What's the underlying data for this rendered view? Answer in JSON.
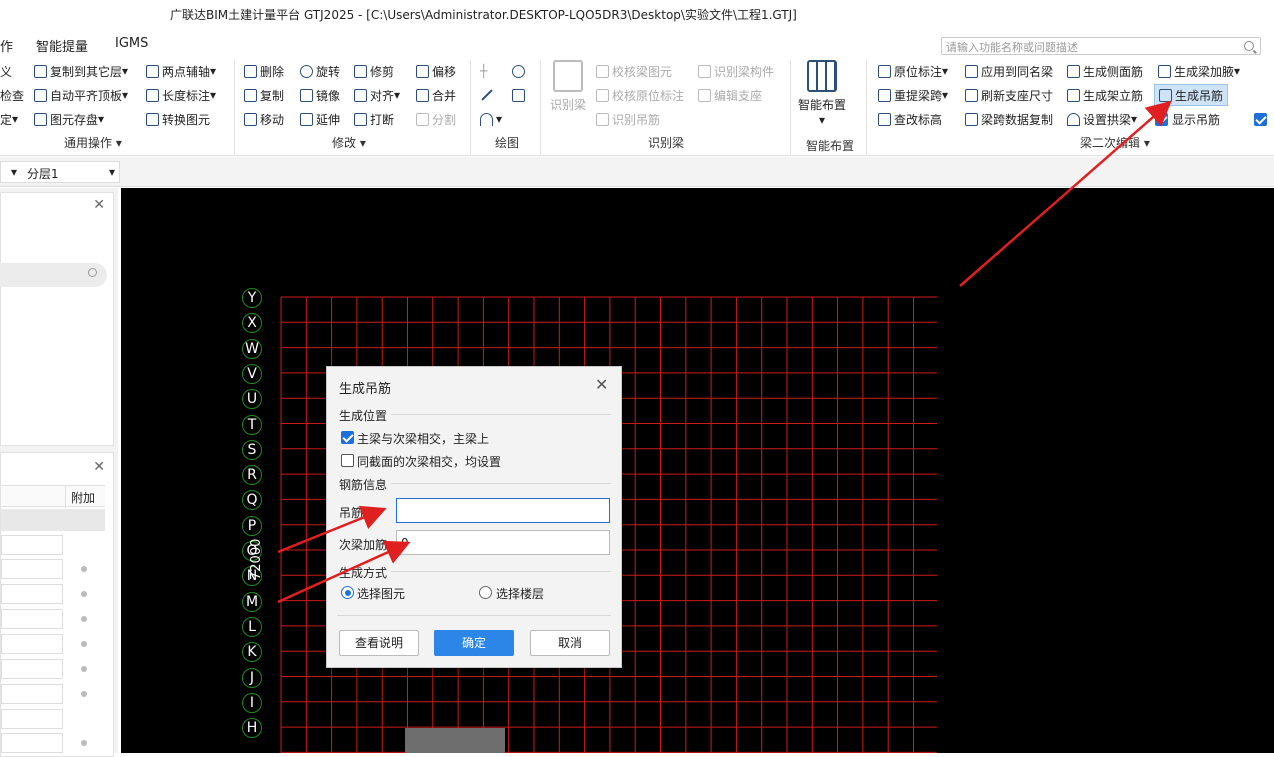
{
  "window": {
    "title": "广联达BIM土建计量平台 GTJ2025 - [C:\\Users\\Administrator.DESKTOP-LQO5DR3\\Desktop\\实验文件\\工程1.GTJ]"
  },
  "menubar": {
    "items": [
      "作",
      "智能提量",
      "IGMS"
    ]
  },
  "search": {
    "placeholder": "请输入功能名称或问题描述"
  },
  "ribbon": {
    "general": {
      "left_clipped": [
        "义",
        "检查",
        "定"
      ],
      "items": [
        "复制到其它层",
        "两点辅轴",
        "自动平齐顶板",
        "长度标注",
        "图元存盘",
        "转换图元"
      ],
      "label": "通用操作"
    },
    "modify": {
      "items": [
        "删除",
        "旋转",
        "修剪",
        "偏移",
        "复制",
        "镜像",
        "对齐",
        "合并",
        "移动",
        "延伸",
        "打断",
        "分割"
      ],
      "label": "修改"
    },
    "draw": {
      "label": "绘图"
    },
    "identify_beam": {
      "items": [
        "识别梁",
        "校核梁图元",
        "识别梁构件",
        "校核原位标注",
        "编辑支座",
        "识别吊筋"
      ],
      "label": "识别梁"
    },
    "smart_layout": {
      "items": [
        "智能布置"
      ],
      "label": "智能布置"
    },
    "beam_edit": {
      "items": [
        "原位标注",
        "应用到同名梁",
        "生成侧面筋",
        "生成梁加腋",
        "重提梁跨",
        "刷新支座尺寸",
        "生成架立筋",
        "生成吊筋",
        "查改标高",
        "梁跨数据复制",
        "设置拱梁",
        "显示吊筋"
      ],
      "label": "梁二次编辑"
    }
  },
  "floor": {
    "selector": "分层1"
  },
  "left_panel": {
    "column_header": "附加"
  },
  "canvas": {
    "axis_labels": [
      "Y",
      "X",
      "W",
      "V",
      "U",
      "T",
      "S",
      "R",
      "Q",
      "P",
      "O",
      "N",
      "M",
      "L",
      "K",
      "J",
      "I",
      "H"
    ],
    "dimension_text": "72000",
    "colors": {
      "grid": "#d01a1a",
      "axis": "#1c8a1c",
      "arrow": "#e02020"
    }
  },
  "dialog": {
    "title": "生成吊筋",
    "section_position": "生成位置",
    "option_main_beam": "主梁与次梁相交，主梁上",
    "option_main_beam_checked": true,
    "option_same_section": "同截面的次梁相交，均设置",
    "option_same_section_checked": false,
    "section_rebar": "钢筋信息",
    "hanger_label": "吊筋:",
    "hanger_value": "",
    "secondary_label": "次梁加筋:",
    "secondary_value": "0",
    "section_method": "生成方式",
    "method_select_element": "选择图元",
    "method_select_floor": "选择楼层",
    "method_selected": "选择图元",
    "btn_help": "查看说明",
    "btn_ok": "确定",
    "btn_cancel": "取消"
  }
}
